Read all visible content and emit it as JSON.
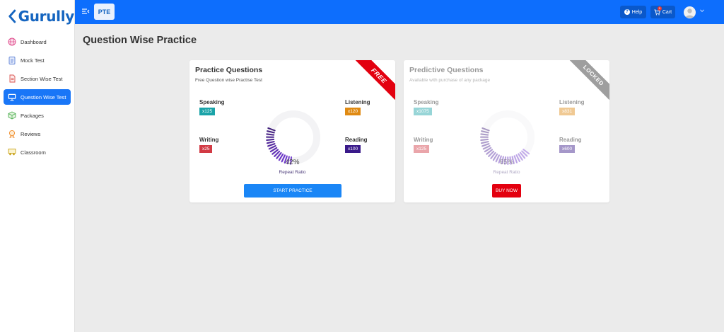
{
  "app": {
    "logo_text": "Gurully",
    "brand_color": "#1565c0",
    "accent_color": "#0d6efd"
  },
  "sidebar": {
    "items": [
      {
        "label": "Dashboard",
        "icon": "globe-icon",
        "active": false
      },
      {
        "label": "Mock Test",
        "icon": "clipboard-icon",
        "active": false
      },
      {
        "label": "Section Wise Test",
        "icon": "document-icon",
        "active": false
      },
      {
        "label": "Question Wise Test",
        "icon": "monitor-icon",
        "active": true
      },
      {
        "label": "Packages",
        "icon": "package-icon",
        "active": false
      },
      {
        "label": "Reviews",
        "icon": "medal-icon",
        "active": false
      },
      {
        "label": "Classroom",
        "icon": "classroom-icon",
        "active": false
      }
    ]
  },
  "topbar": {
    "exam_label": "PTE",
    "help_label": "Help",
    "cart_label": "Cart",
    "cart_count": "0"
  },
  "page": {
    "title": "Question Wise Practice"
  },
  "cards": [
    {
      "title": "Practice Questions",
      "subtitle": "Free Question wise Practise Test",
      "ribbon": "FREE",
      "stats": {
        "speaking": {
          "label": "Speaking",
          "count": "x125",
          "color": "#1aa3a8"
        },
        "listening": {
          "label": "Listening",
          "count": "x120",
          "color": "#e08a12"
        },
        "writing": {
          "label": "Writing",
          "count": "x25",
          "color": "#d23a44"
        },
        "reading": {
          "label": "Reading",
          "count": "x100",
          "color": "#3a1a8a"
        }
      },
      "percent": "42%",
      "percent_value": 42,
      "ratio_label": "Repeat Ratio",
      "button_label": "START PRACTICE",
      "ring_color": "#3d1f82"
    },
    {
      "title": "Predictive Questions",
      "subtitle": "Available with purchase of any package",
      "ribbon": "LOCKED",
      "stats": {
        "speaking": {
          "label": "Speaking",
          "count": "x1075",
          "color": "#1aa3a8"
        },
        "listening": {
          "label": "Listening",
          "count": "x831",
          "color": "#e08a12"
        },
        "writing": {
          "label": "Writing",
          "count": "x125",
          "color": "#d23a44"
        },
        "reading": {
          "label": "Reading",
          "count": "x600",
          "color": "#3a1a8a"
        }
      },
      "percent": "65%",
      "percent_value": 65,
      "ratio_label": "Repeat Ratio",
      "button_label": "BUY NOW",
      "ring_color": "#3d1f82"
    }
  ]
}
